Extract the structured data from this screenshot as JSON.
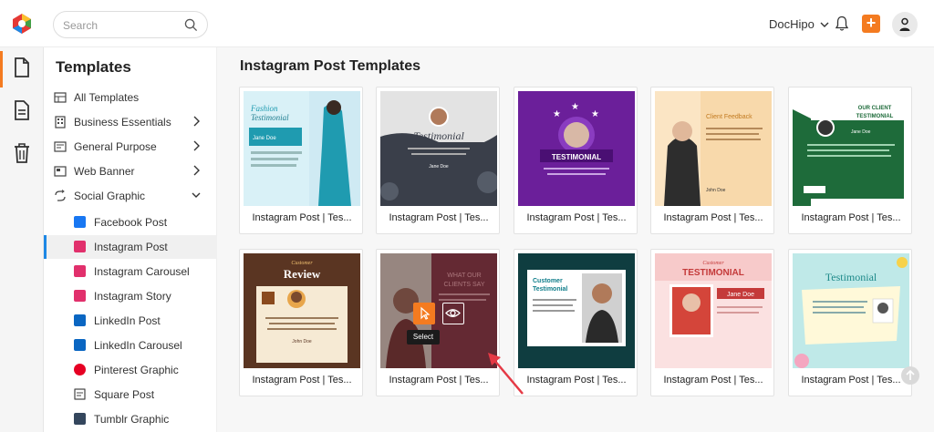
{
  "header": {
    "search_placeholder": "Search",
    "account_name": "DocHipo",
    "plus_label": "+"
  },
  "colors": {
    "accent": "#f47b20",
    "active_nav": "#1e88e5"
  },
  "sidebar": {
    "title": "Templates",
    "items": [
      {
        "label": "All Templates",
        "icon": "grid-icon",
        "chevron": false
      },
      {
        "label": "Business Essentials",
        "icon": "building-icon",
        "chevron": true
      },
      {
        "label": "General Purpose",
        "icon": "list-icon",
        "chevron": true
      },
      {
        "label": "Web Banner",
        "icon": "banner-icon",
        "chevron": true
      },
      {
        "label": "Social Graphic",
        "icon": "share-icon",
        "chevron": true,
        "expanded": true
      }
    ],
    "sub_items": [
      {
        "label": "Facebook Post",
        "icon": "facebook-icon",
        "active": false
      },
      {
        "label": "Instagram Post",
        "icon": "instagram-icon",
        "active": true
      },
      {
        "label": "Instagram Carousel",
        "icon": "instagram-icon",
        "active": false
      },
      {
        "label": "Instagram Story",
        "icon": "instagram-icon",
        "active": false
      },
      {
        "label": "LinkedIn Post",
        "icon": "linkedin-icon",
        "active": false
      },
      {
        "label": "LinkedIn Carousel",
        "icon": "linkedin-icon",
        "active": false
      },
      {
        "label": "Pinterest Graphic",
        "icon": "pinterest-icon",
        "active": false
      },
      {
        "label": "Square Post",
        "icon": "square-icon",
        "active": false
      },
      {
        "label": "Tumblr Graphic",
        "icon": "tumblr-icon",
        "active": false
      }
    ]
  },
  "main": {
    "title": "Instagram Post Templates",
    "hover_actions": {
      "select_label": "Select"
    },
    "cards": [
      {
        "label": "Instagram Post | Tes...",
        "theme": "fashion",
        "heading": "Fashion",
        "subheading": "Testimonial",
        "person": "Jane Doe"
      },
      {
        "label": "Instagram Post | Tes...",
        "theme": "dark-floral",
        "heading": "Testimonial",
        "person": "Jane Doe"
      },
      {
        "label": "Instagram Post | Tes...",
        "theme": "purple",
        "heading": "TESTIMONIAL"
      },
      {
        "label": "Instagram Post | Tes...",
        "theme": "peach",
        "heading": "Client Feedback",
        "person": "John Doe"
      },
      {
        "label": "Instagram Post | Tes...",
        "theme": "green",
        "heading": "OUR CLIENT",
        "subheading": "TESTIMONIAL",
        "person": "Jane Doe"
      },
      {
        "label": "Instagram Post | Tes...",
        "theme": "review",
        "heading": "Customer",
        "subheading": "Review",
        "person": "John Doe"
      },
      {
        "label": "Instagram Post | Tes...",
        "theme": "maroon",
        "heading": "WHAT OUR",
        "subheading": "CLIENTS SAY"
      },
      {
        "label": "Instagram Post | Tes...",
        "theme": "teal",
        "heading": "Customer",
        "subheading": "Testimonial"
      },
      {
        "label": "Instagram Post | Tes...",
        "theme": "pink",
        "heading": "Customer",
        "subheading": "TESTIMONIAL",
        "person": "Jane Doe"
      },
      {
        "label": "Instagram Post | Tes...",
        "theme": "mint",
        "heading": "Testimonial"
      }
    ]
  }
}
